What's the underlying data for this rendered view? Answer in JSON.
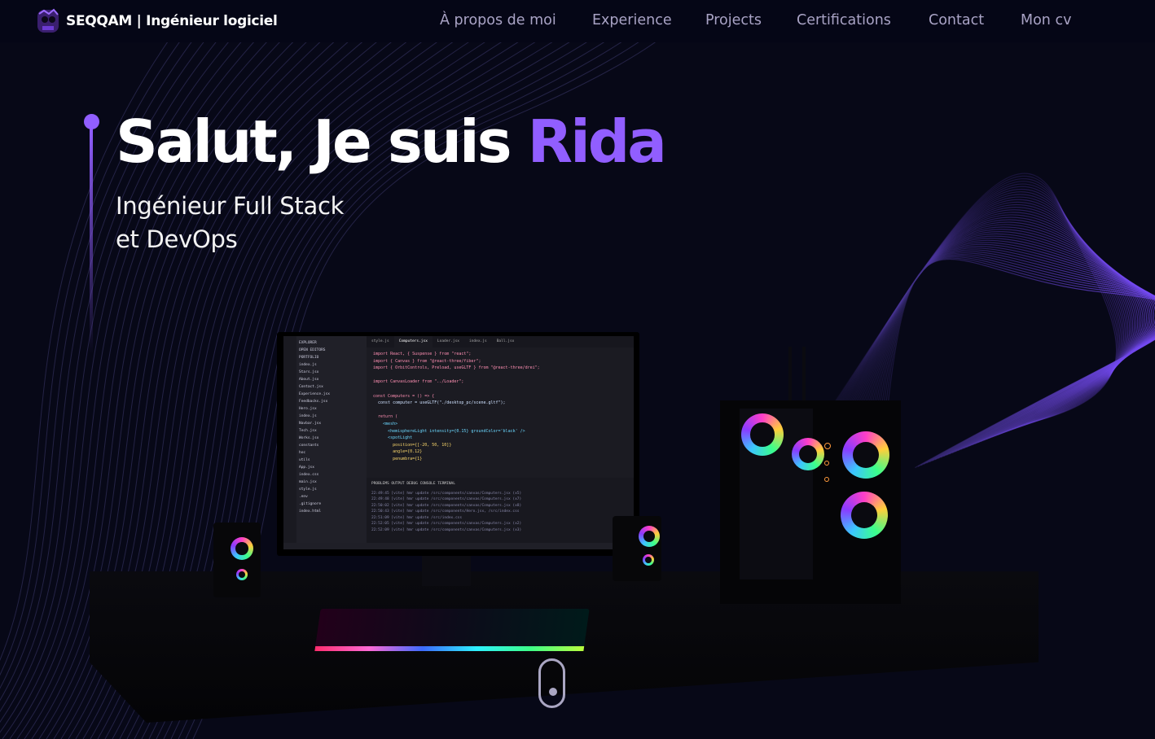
{
  "nav": {
    "brand": "SEQQAM | Ingénieur logiciel",
    "links": [
      "À propos de moi",
      "Experience",
      "Projects",
      "Certifications",
      "Contact",
      "Mon cv"
    ]
  },
  "hero": {
    "greeting": "Salut, Je suis ",
    "name": "Rida",
    "subtitle_line1": "Ingénieur Full Stack",
    "subtitle_line2": "et DevOps"
  },
  "editor": {
    "tabs": [
      "style.js",
      "Computers.jsx",
      "Loader.jsx",
      "index.js",
      "Ball.jsx"
    ],
    "explorer": [
      "EXPLORER",
      "OPEN EDITORS",
      "PORTFOLIO",
      "index.js",
      "Stars.jsx",
      "About.jsx",
      "Contact.jsx",
      "Experience.jsx",
      "Feedbacks.jsx",
      "Hero.jsx",
      "index.js",
      "Navbar.jsx",
      "Tech.jsx",
      "Works.jsx",
      "constants",
      "hoc",
      "utils",
      "App.jsx",
      "index.css",
      "main.jsx",
      "style.js",
      ".env",
      ".gitignore",
      "index.html"
    ],
    "code": [
      "import React, { Suspense } from \"react\";",
      "import { Canvas } from \"@react-three/fiber\";",
      "import { OrbitControls, Preload, useGLTF } from \"@react-three/drei\";",
      "",
      "import CanvasLoader from \"../Loader\";",
      "",
      "const Computers = () => {",
      "  const computer = useGLTF(\"./desktop_pc/scene.gltf\");",
      "",
      "  return (",
      "    <mesh>",
      "      <hemisphereLight intensity={0.15} groundColor='black' />",
      "      <spotLight",
      "        position={[-20, 50, 10]}",
      "        angle={0.12}",
      "        penumbra={1}"
    ],
    "panel_tabs": "PROBLEMS   OUTPUT   DEBUG CONSOLE   TERMINAL",
    "terminal": [
      "22:49:45 [vite] hmr update /src/components/canvas/Computers.jsx (x5)",
      "22:49:48 [vite] hmr update /src/components/canvas/Computers.jsx (x7)",
      "22:50:02 [vite] hmr update /src/components/canvas/Computers.jsx (x8)",
      "22:50:43 [vite] hmr update /src/components/Hero.jsx, /src/index.css",
      "22:51:09 [vite] hmr update /src/index.css",
      "22:52:05 [vite] hmr update /src/components/canvas/Computers.jsx (x2)",
      "22:52:09 [vite] hmr update /src/components/canvas/Computers.jsx (x3)"
    ]
  },
  "colors": {
    "accent": "#915eff",
    "background": "#070817",
    "nav_text": "#a9a3c5"
  },
  "icons": {
    "logo": "skull-avatar-logo",
    "scroll": "mouse-scroll-icon"
  }
}
